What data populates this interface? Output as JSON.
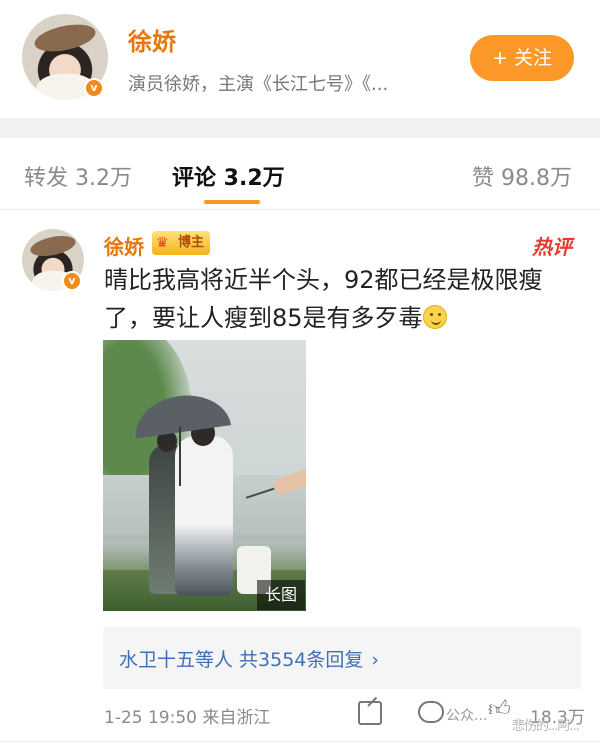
{
  "profile": {
    "name": "徐娇",
    "description": "演员徐娇，主演《长江七号》《...",
    "follow_label": "+ 关注",
    "verified_badge": "v"
  },
  "tabs": {
    "repost": "转发 3.2万",
    "comment": "评论 3.2万",
    "like": "赞 98.8万"
  },
  "comment": {
    "author": "徐娇",
    "badge_label": "博主",
    "hot_label": "热评",
    "verified_badge": "v",
    "text": "晴比我高将近半个头，92都已经是极限瘦了，要让人瘦到85是有多歹毒",
    "image_tag": "长图",
    "replies_text": "水卫十五等人  共3554条回复",
    "replies_chevron": "›",
    "time_location": "1-25 19:50  来自浙江",
    "like_count": "18.3万",
    "watermark_left": "公众...",
    "watermark_right": "悲伤的...阿..."
  },
  "colors": {
    "accent": "#fc9827",
    "name": "#e8770a",
    "link": "#3f6fb6",
    "hot": "#e63b2e"
  },
  "icons": {
    "share": "share-icon",
    "comment": "comment-icon",
    "like": "thumbs-up-icon",
    "chevron": "chevron-right-icon",
    "emoji": "smile-emoji-icon"
  }
}
